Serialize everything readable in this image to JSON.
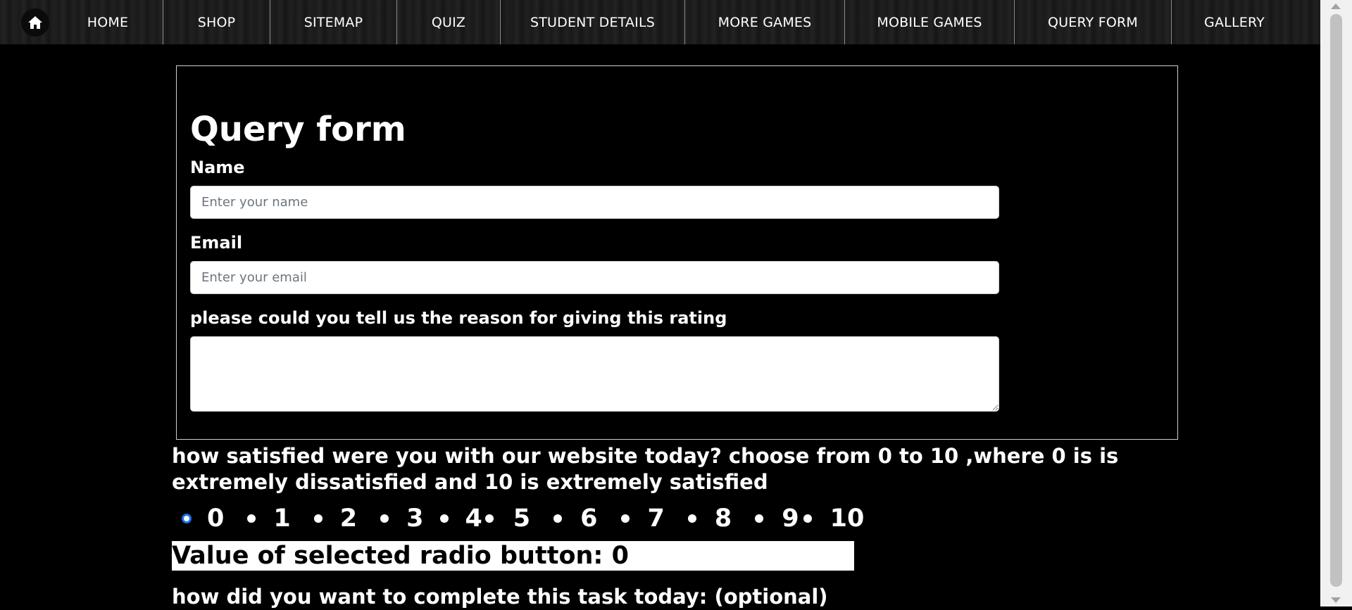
{
  "nav": {
    "home_icon": "home-icon",
    "items": [
      {
        "label": "HOME"
      },
      {
        "label": "SHOP"
      },
      {
        "label": "SITEMAP"
      },
      {
        "label": "QUIZ"
      },
      {
        "label": "STUDENT DETAILS"
      },
      {
        "label": "MORE GAMES"
      },
      {
        "label": "MOBILE GAMES"
      },
      {
        "label": "QUERY FORM"
      },
      {
        "label": "GALLERY"
      }
    ]
  },
  "form": {
    "title": "Query form",
    "name_label": "Name",
    "name_placeholder": "Enter your name",
    "email_label": "Email",
    "email_placeholder": "Enter your email",
    "reason_label": "please could you tell us the reason for giving this rating"
  },
  "rating": {
    "question": "how satisfied were you with our website today? choose from 0 to 10 ,where 0 is is extremely dissatisfied and 10 is extremely satisfied",
    "options": [
      "0",
      "1",
      "2",
      "3",
      "4",
      "5",
      "6",
      "7",
      "8",
      "9",
      "10"
    ],
    "selected": "0",
    "value_text": "Value of selected radio button: 0"
  },
  "task_question": "how did you want to complete this task today: (optional)",
  "colors": {
    "background": "#000000",
    "radio_selected": "#1a73e8"
  }
}
